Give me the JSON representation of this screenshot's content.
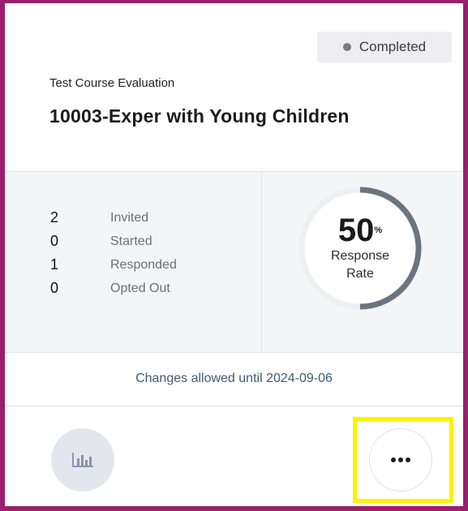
{
  "header": {
    "status": "Completed",
    "course_type": "Test Course Evaluation",
    "course_title": "10003-Exper with Young Children"
  },
  "stats": [
    {
      "value": "2",
      "label": "Invited"
    },
    {
      "value": "0",
      "label": "Started"
    },
    {
      "value": "1",
      "label": "Responded"
    },
    {
      "value": "0",
      "label": "Opted Out"
    }
  ],
  "response_rate": {
    "value": "50",
    "unit": "%",
    "label": "Response Rate",
    "fraction": 0.5
  },
  "changes_note": "Changes allowed until 2024-09-06",
  "icons": {
    "report": "bar-chart-icon",
    "more": "more-options-icon",
    "status": "status-dot-icon"
  },
  "colors": {
    "frame": "#9b1f6a",
    "highlight": "#fff200",
    "gauge_track": "#eeeff2",
    "gauge_fill": "#6b7480"
  }
}
